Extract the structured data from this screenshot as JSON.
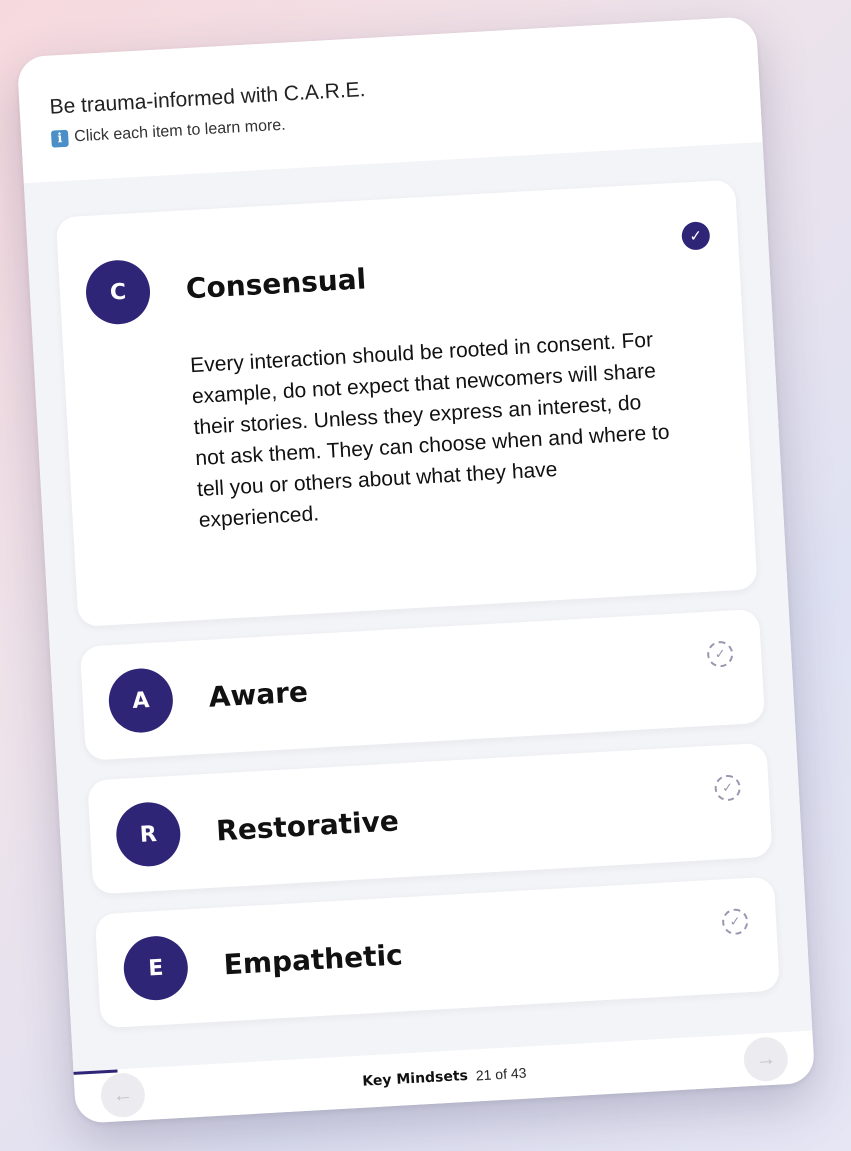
{
  "header": {
    "title": "Be trauma-informed with C.A.R.E.",
    "hint": "Click each item to learn more.",
    "hint_icon": "info-icon"
  },
  "items": [
    {
      "letter": "C",
      "title": "Consensual",
      "expanded": true,
      "completed": true,
      "text": "Every interaction should be rooted in consent. For example, do not expect that newcomers will share their stories. Unless they express an interest, do not ask them. They can choose when and where to tell you or others about what they have experienced."
    },
    {
      "letter": "A",
      "title": "Aware",
      "expanded": false,
      "completed": false
    },
    {
      "letter": "R",
      "title": "Restorative",
      "expanded": false,
      "completed": false
    },
    {
      "letter": "E",
      "title": "Empathetic",
      "expanded": false,
      "completed": false
    }
  ],
  "footer": {
    "section": "Key Mindsets",
    "counter": "21 of 43",
    "progress_fraction": 0.06,
    "prev_icon": "arrow-left-icon",
    "next_icon": "arrow-right-icon"
  },
  "colors": {
    "accent": "#2f2577",
    "panel": "#f3f4f7"
  }
}
